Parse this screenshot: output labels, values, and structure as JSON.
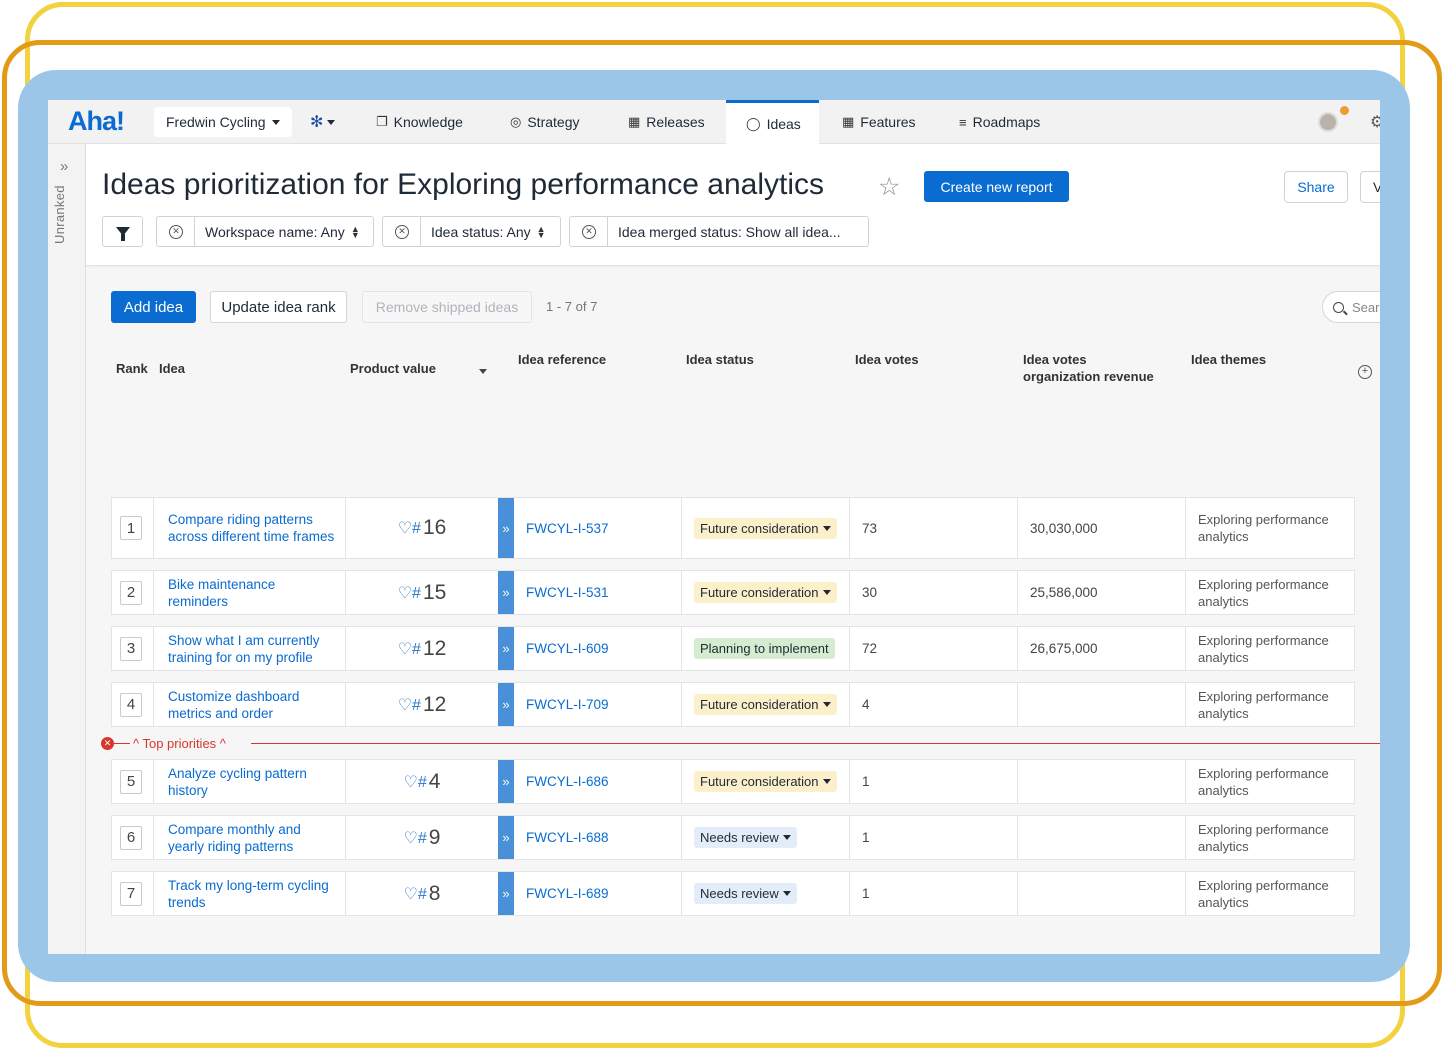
{
  "app": {
    "logo": "Aha!",
    "workspace": "Fredwin Cycling",
    "nav": [
      {
        "label": "Knowledge",
        "icon": "knowledge-icon"
      },
      {
        "label": "Strategy",
        "icon": "strategy-icon"
      },
      {
        "label": "Releases",
        "icon": "calendar-icon"
      },
      {
        "label": "Ideas",
        "icon": "lightbulb-icon",
        "active": true
      },
      {
        "label": "Features",
        "icon": "grid-icon"
      },
      {
        "label": "Roadmaps",
        "icon": "roadmap-icon"
      }
    ]
  },
  "rail": {
    "label": "Unranked"
  },
  "header": {
    "title": "Ideas prioritization for Exploring performance analytics",
    "create_label": "Create new report",
    "share_label": "Share",
    "view_label": "V",
    "filters": {
      "workspace": "Workspace name: Any",
      "status": "Idea status: Any",
      "merged": "Idea merged status: Show all idea..."
    }
  },
  "toolbar": {
    "add_label": "Add idea",
    "update_label": "Update idea rank",
    "remove_label": "Remove shipped ideas",
    "pager": "1 - 7 of 7",
    "search_placeholder": "Sear"
  },
  "columns": {
    "rank": "Rank",
    "idea": "Idea",
    "product_value": "Product value",
    "reference": "Idea reference",
    "status": "Idea status",
    "votes": "Idea votes",
    "revenue_1": "Idea votes",
    "revenue_2": "organization revenue",
    "themes": "Idea themes"
  },
  "divider": {
    "label": "^ Top priorities ^"
  },
  "rows": [
    {
      "rank": "1",
      "idea": "Compare riding patterns across different time frames",
      "value": "16",
      "ref": "FWCYL-I-537",
      "status": "Future consideration",
      "status_type": "future",
      "votes": "73",
      "revenue": "30,030,000",
      "theme": "Exploring performance analytics"
    },
    {
      "rank": "2",
      "idea": "Bike maintenance reminders",
      "value": "15",
      "ref": "FWCYL-I-531",
      "status": "Future consideration",
      "status_type": "future",
      "votes": "30",
      "revenue": "25,586,000",
      "theme": "Exploring performance analytics"
    },
    {
      "rank": "3",
      "idea": "Show what I am currently training for on my profile",
      "value": "12",
      "ref": "FWCYL-I-609",
      "status": "Planning to implement",
      "status_type": "planning",
      "votes": "72",
      "revenue": "26,675,000",
      "theme": "Exploring performance analytics"
    },
    {
      "rank": "4",
      "idea": "Customize dashboard metrics and order",
      "value": "12",
      "ref": "FWCYL-I-709",
      "status": "Future consideration",
      "status_type": "future",
      "votes": "4",
      "revenue": "",
      "theme": "Exploring performance analytics"
    },
    {
      "rank": "5",
      "idea": "Analyze cycling pattern history",
      "value": "4",
      "ref": "FWCYL-I-686",
      "status": "Future consideration",
      "status_type": "future",
      "votes": "1",
      "revenue": "",
      "theme": "Exploring performance analytics"
    },
    {
      "rank": "6",
      "idea": "Compare monthly and yearly riding patterns",
      "value": "9",
      "ref": "FWCYL-I-688",
      "status": "Needs review",
      "status_type": "review",
      "votes": "1",
      "revenue": "",
      "theme": "Exploring performance analytics"
    },
    {
      "rank": "7",
      "idea": "Track my long-term cycling trends",
      "value": "8",
      "ref": "FWCYL-I-689",
      "status": "Needs review",
      "status_type": "review",
      "votes": "1",
      "revenue": "",
      "theme": "Exploring performance analytics"
    }
  ],
  "colors": {
    "brand": "#0a6bd0",
    "future": "#fbf0c9",
    "planning": "#d6ecd0",
    "review": "#e3edf9",
    "divider": "#d9362b"
  }
}
